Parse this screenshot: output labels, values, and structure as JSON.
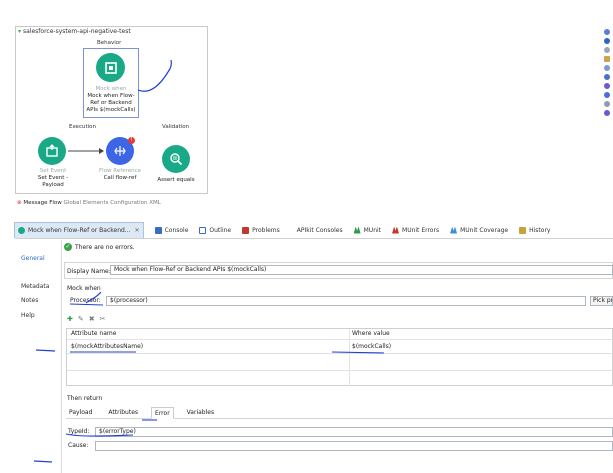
{
  "canvas": {
    "flow_name": "salesforce-system-api-negative-test",
    "behavior_label": "Behavior",
    "execution_label": "Execution",
    "validation_label": "Validation",
    "mock_component": {
      "type_label": "Mock when",
      "caption": [
        "Mock when Flow-",
        "Ref or Backend",
        "APIs  $(mockCalls)"
      ]
    },
    "set_event": {
      "type_label": "Set Event",
      "caption": [
        "Set Event -",
        "Payload"
      ]
    },
    "flow_reference": {
      "type_label": "Flow Reference",
      "caption": [
        "Call flow-ref"
      ]
    },
    "assert": {
      "caption": [
        "Assert equals"
      ]
    }
  },
  "canvas_tabs": {
    "message_flow": "Message Flow",
    "global": "Global Elements",
    "config": "Configuration XML"
  },
  "view_tabs": [
    {
      "label": "Mock when Flow-Ref or Backend...",
      "icon_color": "#19a987"
    },
    {
      "label": "Console",
      "icon_color": "#3b6bc7"
    },
    {
      "label": "Outline",
      "icon_color": "#3b6bc7"
    },
    {
      "label": "Problems",
      "icon_color": "#c0392b"
    },
    {
      "label": "APIkit Consoles",
      "icon_color": ""
    },
    {
      "label": "MUnit",
      "icon_color": "#2e9c4a"
    },
    {
      "label": "MUnit Errors",
      "icon_color": "#c0392b"
    },
    {
      "label": "MUnit Coverage",
      "icon_color": "#3b8fd6"
    },
    {
      "label": "History",
      "icon_color": "#c8a13a"
    }
  ],
  "side_nav": [
    "General",
    "Metadata",
    "Notes",
    "Help"
  ],
  "status_message": "There are no errors.",
  "display_name": {
    "label": "Display Name:",
    "value": "Mock when Flow-Ref or Backend APIs  $(mockCalls)"
  },
  "mock_when_label": "Mock when",
  "processor": {
    "label": "Processor:",
    "value": "$(processor)",
    "button": "Pick pro"
  },
  "table": {
    "headers": [
      "Attribute name",
      "Where value"
    ],
    "rows": [
      [
        "$(mockAttributesName)",
        "$(mockCalls)"
      ]
    ]
  },
  "then_return_label": "Then return",
  "sub_tabs": [
    "Payload",
    "Attributes",
    "Error",
    "Variables"
  ],
  "type_id": {
    "label": "TypeId:",
    "value": "$(errorType)"
  },
  "cause_label": "Cause:"
}
